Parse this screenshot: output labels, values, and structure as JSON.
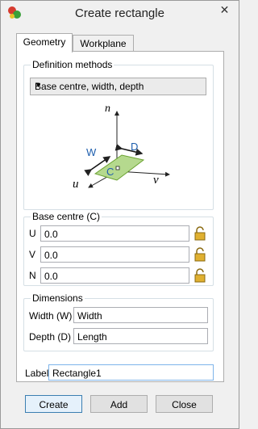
{
  "window": {
    "title": "Create rectangle",
    "close_glyph": "✕"
  },
  "tabs": [
    {
      "label": "Geometry",
      "active": true
    },
    {
      "label": "Workplane",
      "active": false
    }
  ],
  "definition": {
    "group_label": "Definition methods",
    "method": "Base centre, width, depth"
  },
  "diagram": {
    "axis_n": "n",
    "axis_u": "u",
    "axis_v": "v",
    "label_w": "W",
    "label_d": "D",
    "label_c": "C"
  },
  "base_centre": {
    "group_label": "Base centre (C)",
    "rows": [
      {
        "label": "U",
        "value": "0.0"
      },
      {
        "label": "V",
        "value": "0.0"
      },
      {
        "label": "N",
        "value": "0.0"
      }
    ]
  },
  "dimensions": {
    "group_label": "Dimensions",
    "rows": [
      {
        "label": "Width (W)",
        "value": "Width"
      },
      {
        "label": "Depth (D)",
        "value": "Length"
      }
    ]
  },
  "label_field": {
    "label": "Label",
    "value": "Rectangle1"
  },
  "buttons": {
    "create": "Create",
    "add": "Add",
    "close": "Close"
  },
  "colors": {
    "plane_fill": "#b5d98e",
    "plane_stroke": "#6aa230",
    "dim_label": "#1f5fae",
    "lock": "#e0b030"
  }
}
